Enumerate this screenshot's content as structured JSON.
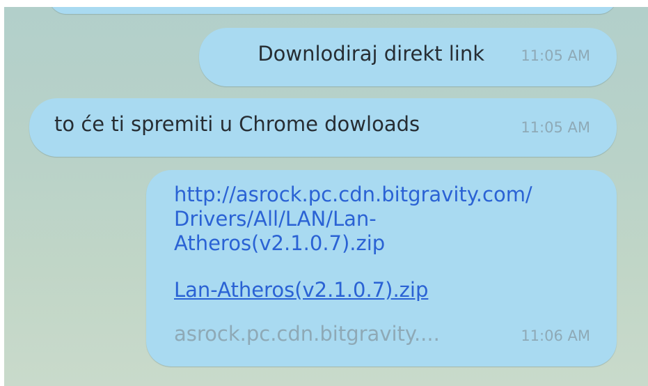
{
  "messages": [
    {
      "text": "Downlodiraj direkt link",
      "time": "11:05 AM"
    },
    {
      "text": "to će ti spremiti u Chrome dowloads",
      "time": "11:05 AM"
    },
    {
      "url_line1": "http://asrock.pc.cdn.bitgravity.com/",
      "url_line2": "Drivers/All/LAN/Lan-",
      "url_line3": "Atheros(v2.1.0.7).zip",
      "link_title": "Lan-Atheros(v2.1.0.7).zip",
      "link_domain": "asrock.pc.cdn.bitgravity....",
      "time": "11:06 AM"
    }
  ],
  "colors": {
    "bubble": "#a9daf1",
    "link": "#2a62d4",
    "timestamp": "#8ea9b6",
    "text": "#262d33",
    "background": "#b9d2c8"
  }
}
